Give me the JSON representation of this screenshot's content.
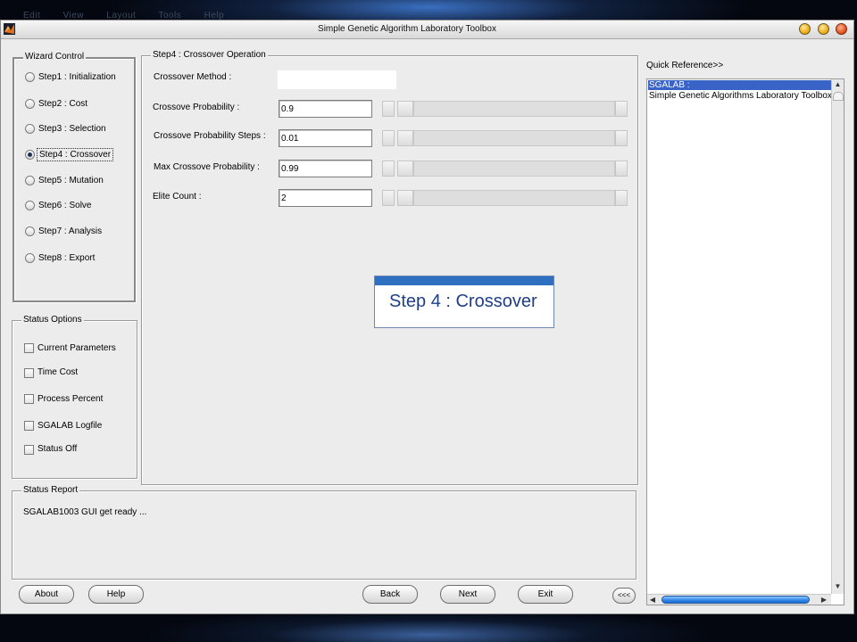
{
  "menu": [
    "Edit",
    "View",
    "Layout",
    "Tools",
    "Help"
  ],
  "window": {
    "title": "Simple Genetic Algorithm Laboratory Toolbox"
  },
  "wizard": {
    "title": "Wizard Control",
    "selected": 3,
    "steps": [
      "Step1 : Initialization",
      "Step2 : Cost",
      "Step3 : Selection",
      "Step4 : Crossover",
      "Step5 : Mutation",
      "Step6 : Solve",
      "Step7 : Analysis",
      "Step8 : Export"
    ]
  },
  "status_options": {
    "title": "Status Options",
    "items": [
      "Current Parameters",
      "Time Cost",
      "Process Percent",
      "SGALAB Logfile",
      "Status Off"
    ]
  },
  "crossover": {
    "title": "Step4 : Crossover Operation",
    "method_label": "Crossover Method :",
    "method_value": "",
    "fields": [
      {
        "label": "Crossove Probability :",
        "value": "0.9"
      },
      {
        "label": "Crossove Probability  Steps :",
        "value": "0.01"
      },
      {
        "label": "Max Crossove Probability :",
        "value": "0.99"
      },
      {
        "label": "Elite Count :",
        "value": "2"
      }
    ],
    "banner": "Step 4 : Crossover"
  },
  "quick_reference": {
    "title": "Quick Reference>>",
    "items": [
      "SGALAB :",
      "Simple Genetic Algorithms Laboratory Toolbox"
    ],
    "selected": 0
  },
  "status_report": {
    "title": "Status Report",
    "text": "SGALAB1003 GUI get ready ..."
  },
  "buttons": {
    "about": "About",
    "help": "Help",
    "back": "Back",
    "next": "Next",
    "exit": "Exit",
    "collapse": "<<<"
  },
  "colors": {
    "window_bg": "#ececec",
    "selection": "#3a63c8",
    "banner_accent": "#2f6fc0",
    "banner_text": "#1e3f86",
    "scroll_thumb": "#2f86e8"
  }
}
